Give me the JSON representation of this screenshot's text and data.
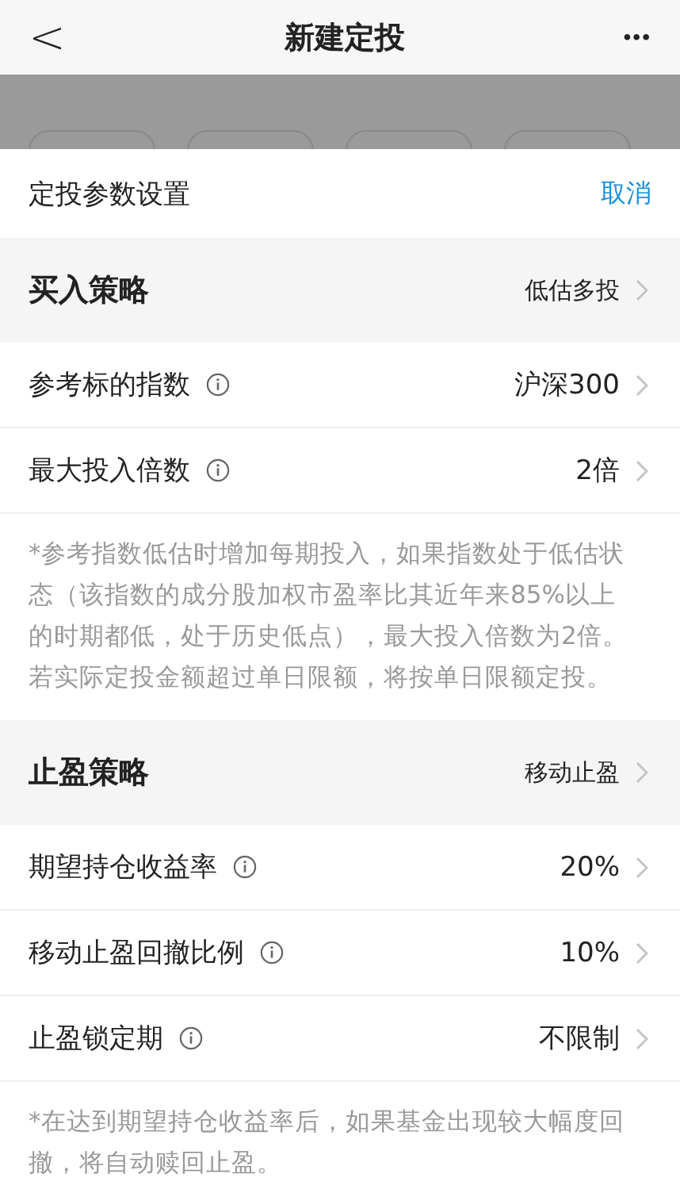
{
  "nav": {
    "title": "新建定投",
    "back": "<",
    "more": "•••"
  },
  "sheet": {
    "title": "定投参数设置",
    "cancel": "取消"
  },
  "sections": [
    {
      "title": "买入策略",
      "value": "低估多投",
      "rows": [
        {
          "label": "参考标的指数",
          "value": "沪深300"
        },
        {
          "label": "最大投入倍数",
          "value": "2倍"
        }
      ],
      "note": "*参考指数低估时增加每期投入，如果指数处于低估状态（该指数的成分股加权市盈率比其近年来85%以上的时期都低，处于历史低点），最大投入倍数为2倍。若实际定投金额超过单日限额，将按单日限额定投。"
    },
    {
      "title": "止盈策略",
      "value": "移动止盈",
      "rows": [
        {
          "label": "期望持仓收益率",
          "value": "20%"
        },
        {
          "label": "移动止盈回撤比例",
          "value": "10%"
        },
        {
          "label": "止盈锁定期",
          "value": "不限制"
        }
      ],
      "note": "*在达到期望持仓收益率后，如果基金出现较大幅度回撤，将自动赎回止盈。"
    }
  ]
}
